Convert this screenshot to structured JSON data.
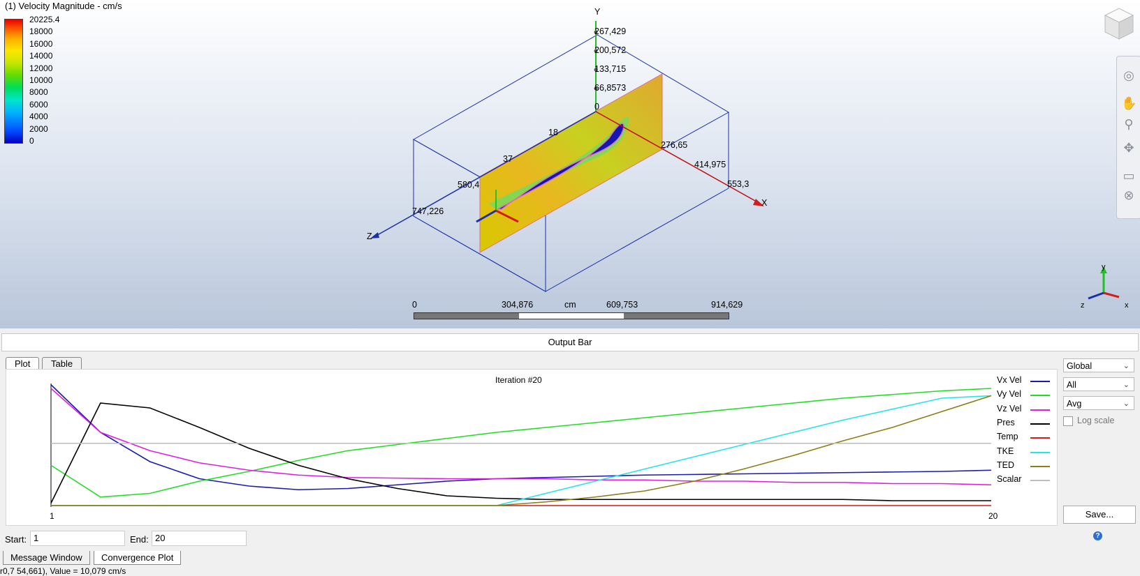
{
  "viewport": {
    "title": "(1) Velocity Magnitude - cm/s",
    "legend": {
      "values": [
        "20225.4",
        "18000",
        "16000",
        "14000",
        "12000",
        "10000",
        "8000",
        "6000",
        "4000",
        "2000",
        "0"
      ]
    },
    "axis_labels": {
      "y": "Y",
      "x": "X",
      "z": "Z"
    },
    "y_ticks": [
      "267,429",
      "200,572",
      "133,715",
      "66,8573",
      "0"
    ],
    "x_ticks": [
      "276,65",
      "414,975",
      "553,3"
    ],
    "z_ticks": [
      "580,4",
      "747,226"
    ],
    "partial_ticks": [
      "18",
      "37"
    ],
    "scale": {
      "ticks": [
        "0",
        "304,876",
        "609,753",
        "914,629"
      ],
      "unit": "cm"
    },
    "triad": {
      "y": "y",
      "x": "x",
      "z": "z"
    }
  },
  "output_bar": {
    "label": "Output Bar"
  },
  "tabs": [
    {
      "label": "Plot"
    },
    {
      "label": "Table"
    }
  ],
  "plot": {
    "title": "Iteration #20",
    "x_start_label": "1",
    "x_end_label": "20"
  },
  "chart_data": {
    "type": "line",
    "title": "Iteration #20",
    "x": [
      1,
      2,
      3,
      4,
      5,
      6,
      7,
      8,
      9,
      10,
      11,
      12,
      13,
      14,
      15,
      16,
      17,
      18,
      19,
      20
    ],
    "ylim": [
      0,
      1
    ],
    "series": [
      {
        "name": "Vx Vel",
        "color": "#1a1ab4",
        "values": [
          0.99,
          0.6,
          0.36,
          0.22,
          0.16,
          0.13,
          0.14,
          0.17,
          0.2,
          0.22,
          0.23,
          0.24,
          0.25,
          0.255,
          0.26,
          0.265,
          0.27,
          0.275,
          0.28,
          0.29
        ]
      },
      {
        "name": "Vy Vel",
        "color": "#1ee01e",
        "values": [
          0.33,
          0.07,
          0.1,
          0.2,
          0.28,
          0.37,
          0.45,
          0.5,
          0.55,
          0.6,
          0.64,
          0.68,
          0.72,
          0.76,
          0.8,
          0.84,
          0.88,
          0.91,
          0.94,
          0.96
        ]
      },
      {
        "name": "Vz Vel",
        "color": "#e01ee0",
        "values": [
          0.96,
          0.6,
          0.45,
          0.35,
          0.29,
          0.25,
          0.23,
          0.225,
          0.22,
          0.22,
          0.22,
          0.21,
          0.21,
          0.2,
          0.2,
          0.19,
          0.19,
          0.18,
          0.18,
          0.17
        ]
      },
      {
        "name": "Pres",
        "color": "#000000",
        "values": [
          0.02,
          0.84,
          0.8,
          0.64,
          0.47,
          0.33,
          0.22,
          0.14,
          0.08,
          0.06,
          0.05,
          0.05,
          0.05,
          0.05,
          0.05,
          0.05,
          0.05,
          0.04,
          0.04,
          0.04
        ]
      },
      {
        "name": "Temp",
        "color": "#d21e1e",
        "values": [
          0,
          0,
          0,
          0,
          0,
          0,
          0,
          0,
          0,
          0,
          0,
          0,
          0,
          0,
          0,
          0,
          0,
          0,
          0,
          0
        ]
      },
      {
        "name": "TKE",
        "color": "#23e6e6",
        "values": [
          0,
          0,
          0,
          0,
          0,
          0,
          0,
          0,
          0,
          0,
          0.1,
          0.2,
          0.3,
          0.4,
          0.5,
          0.6,
          0.7,
          0.79,
          0.88,
          0.9
        ]
      },
      {
        "name": "TED",
        "color": "#8c7d14",
        "values": [
          0,
          0,
          0,
          0,
          0,
          0,
          0,
          0,
          0,
          0,
          0.03,
          0.07,
          0.12,
          0.2,
          0.3,
          0.41,
          0.53,
          0.64,
          0.77,
          0.9
        ]
      },
      {
        "name": "Scalar",
        "color": "#bdbdbd",
        "values": [
          0.51,
          0.51,
          0.51,
          0.51,
          0.51,
          0.51,
          0.51,
          0.51,
          0.51,
          0.51,
          0.51,
          0.51,
          0.51,
          0.51,
          0.51,
          0.51,
          0.51,
          0.51,
          0.51,
          0.51
        ]
      }
    ],
    "legend": "right"
  },
  "controls": {
    "scope": "Global",
    "filter": "All",
    "stat": "Avg",
    "log_scale_label": "Log scale",
    "save_label": "Save..."
  },
  "range": {
    "start_label": "Start:",
    "start_value": "1",
    "end_label": "End:",
    "end_value": "20"
  },
  "bottom_tabs": [
    {
      "label": "Message Window"
    },
    {
      "label": "Convergence Plot"
    }
  ],
  "status": "r0,7 54,661), Value = 10,079 cm/s"
}
